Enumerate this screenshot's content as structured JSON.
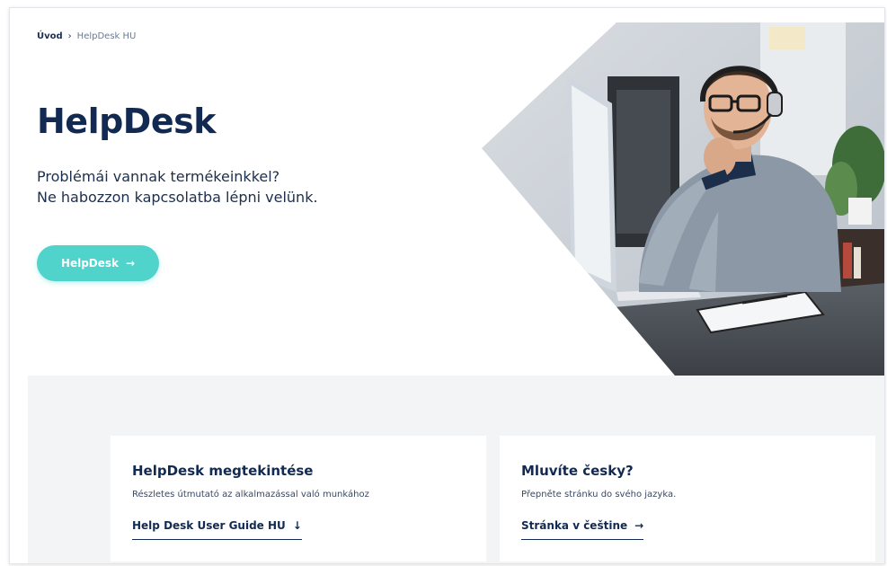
{
  "breadcrumb": {
    "home": "Úvod",
    "separator": "›",
    "current": "HelpDesk HU"
  },
  "hero": {
    "title": "HelpDesk",
    "subtitle_line1": "Problémái vannak termékeinkkel?",
    "subtitle_line2": "Ne habozzon kapcsolatba lépni velünk.",
    "button_label": "HelpDesk",
    "button_arrow": "→"
  },
  "cards": [
    {
      "title": "HelpDesk megtekintése",
      "description": "Részletes útmutató az alkalmazással való munkához",
      "link_label": "Help Desk User Guide HU",
      "link_icon": "↓"
    },
    {
      "title": "Mluvíte česky?",
      "description": "Přepněte stránku do svého jazyka.",
      "link_label": "Stránka v češtine",
      "link_icon": "→"
    }
  ],
  "colors": {
    "accent": "#4fd3cb",
    "heading": "#122a52",
    "panel_bg": "#f2f4f6"
  }
}
